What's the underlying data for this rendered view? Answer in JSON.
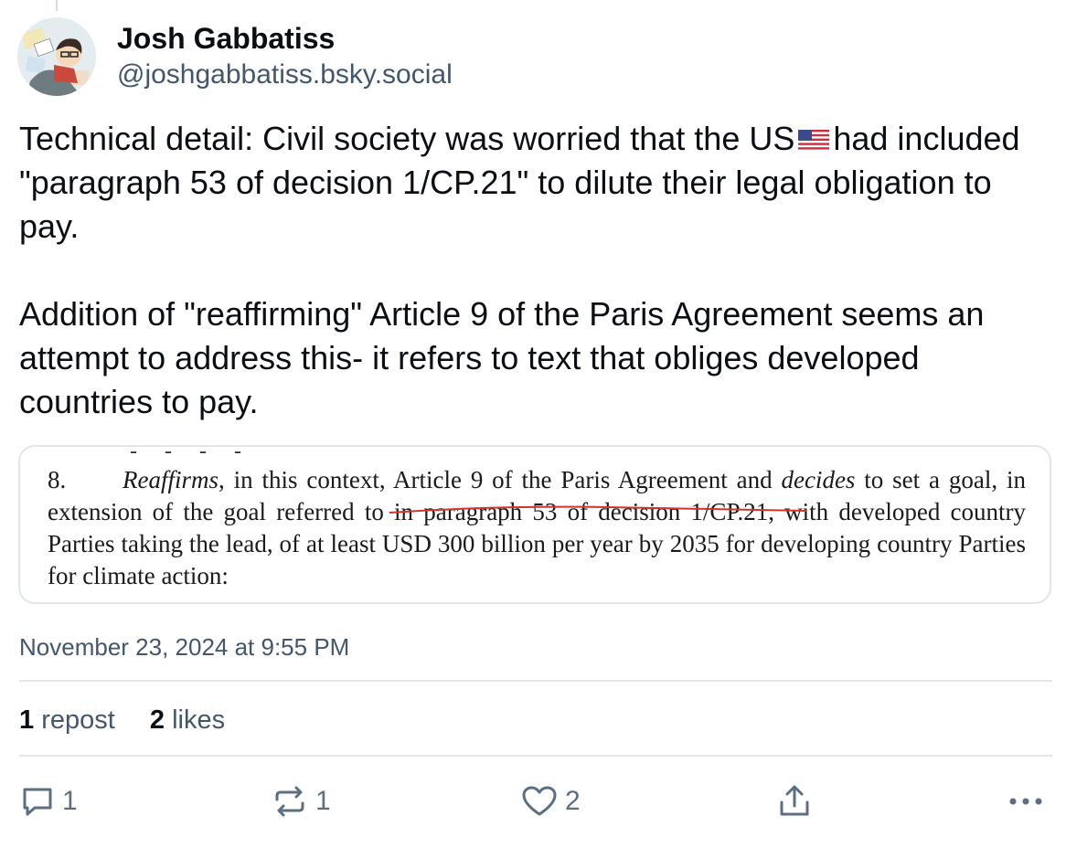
{
  "post": {
    "author_name": "Josh Gabbatiss",
    "author_handle": "@joshgabbatiss.bsky.social",
    "text_p1_before_flag": "Technical detail: Civil society was worried that the US",
    "flag_emoji": "us-flag",
    "text_p1_after_flag": "had included \"paragraph 53 of decision 1/CP.21\" to dilute their legal obligation to pay.",
    "text_p2": "Addition of \"reaffirming\" Article 9 of the Paris Agreement seems an attempt to address this- it refers to text that obliges developed countries to pay.",
    "timestamp": "November 23, 2024 at 9:55 PM"
  },
  "embed": {
    "cut_text": "- - - -",
    "para_num": "8.",
    "reaffirms": "Reaffirms",
    "t1": ", in this context, ",
    "highlight": "Article 9 of the Paris Agreement",
    "t2": " and ",
    "decides": "decides",
    "t3": " to set a goal, in extension of the goal referred to in paragraph 53 of decision 1/CP.21, with developed country Parties taking the lead, of at least USD 300 billion per year by 2035 for developing country Parties for climate action:",
    "underline_color": "#d0342c"
  },
  "stats": {
    "reposts_count": "1",
    "reposts_label": "repost",
    "likes_count": "2",
    "likes_label": "likes"
  },
  "actions": {
    "reply_icon": "reply-icon",
    "reply_count": "1",
    "repost_icon": "repost-icon",
    "repost_count": "1",
    "like_icon": "heart-icon",
    "like_count": "2",
    "share_icon": "share-icon",
    "more_icon": "more-icon",
    "icon_color": "#5b6f83"
  }
}
